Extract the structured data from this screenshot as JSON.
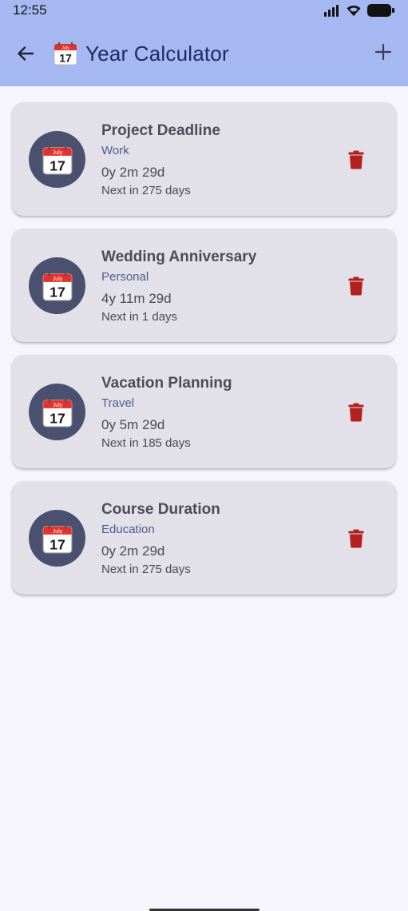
{
  "status_bar": {
    "time": "12:55",
    "icons": [
      "signal-icon",
      "wifi-icon",
      "battery-icon"
    ]
  },
  "app_bar": {
    "title": "Year Calculator",
    "title_icon": "calendar-icon",
    "back_icon": "arrow-back-icon",
    "add_icon": "plus-icon",
    "background": "#a6b8f1"
  },
  "calendar_icon": {
    "month": "July",
    "day": "17"
  },
  "items": [
    {
      "title": "Project Deadline",
      "category": "Work",
      "duration": "0y 2m 29d",
      "next": "Next in 275 days"
    },
    {
      "title": "Wedding Anniversary",
      "category": "Personal",
      "duration": "4y 11m 29d",
      "next": "Next in 1 days"
    },
    {
      "title": "Vacation Planning",
      "category": "Travel",
      "duration": "0y 5m 29d",
      "next": "Next in 185 days"
    },
    {
      "title": "Course Duration",
      "category": "Education",
      "duration": "0y 2m 29d",
      "next": "Next in 275 days"
    }
  ],
  "colors": {
    "card_bg": "#e2e1ea",
    "avatar_bg": "#4a506e",
    "delete": "#b3201e",
    "category_text": "#4f5a8c"
  }
}
